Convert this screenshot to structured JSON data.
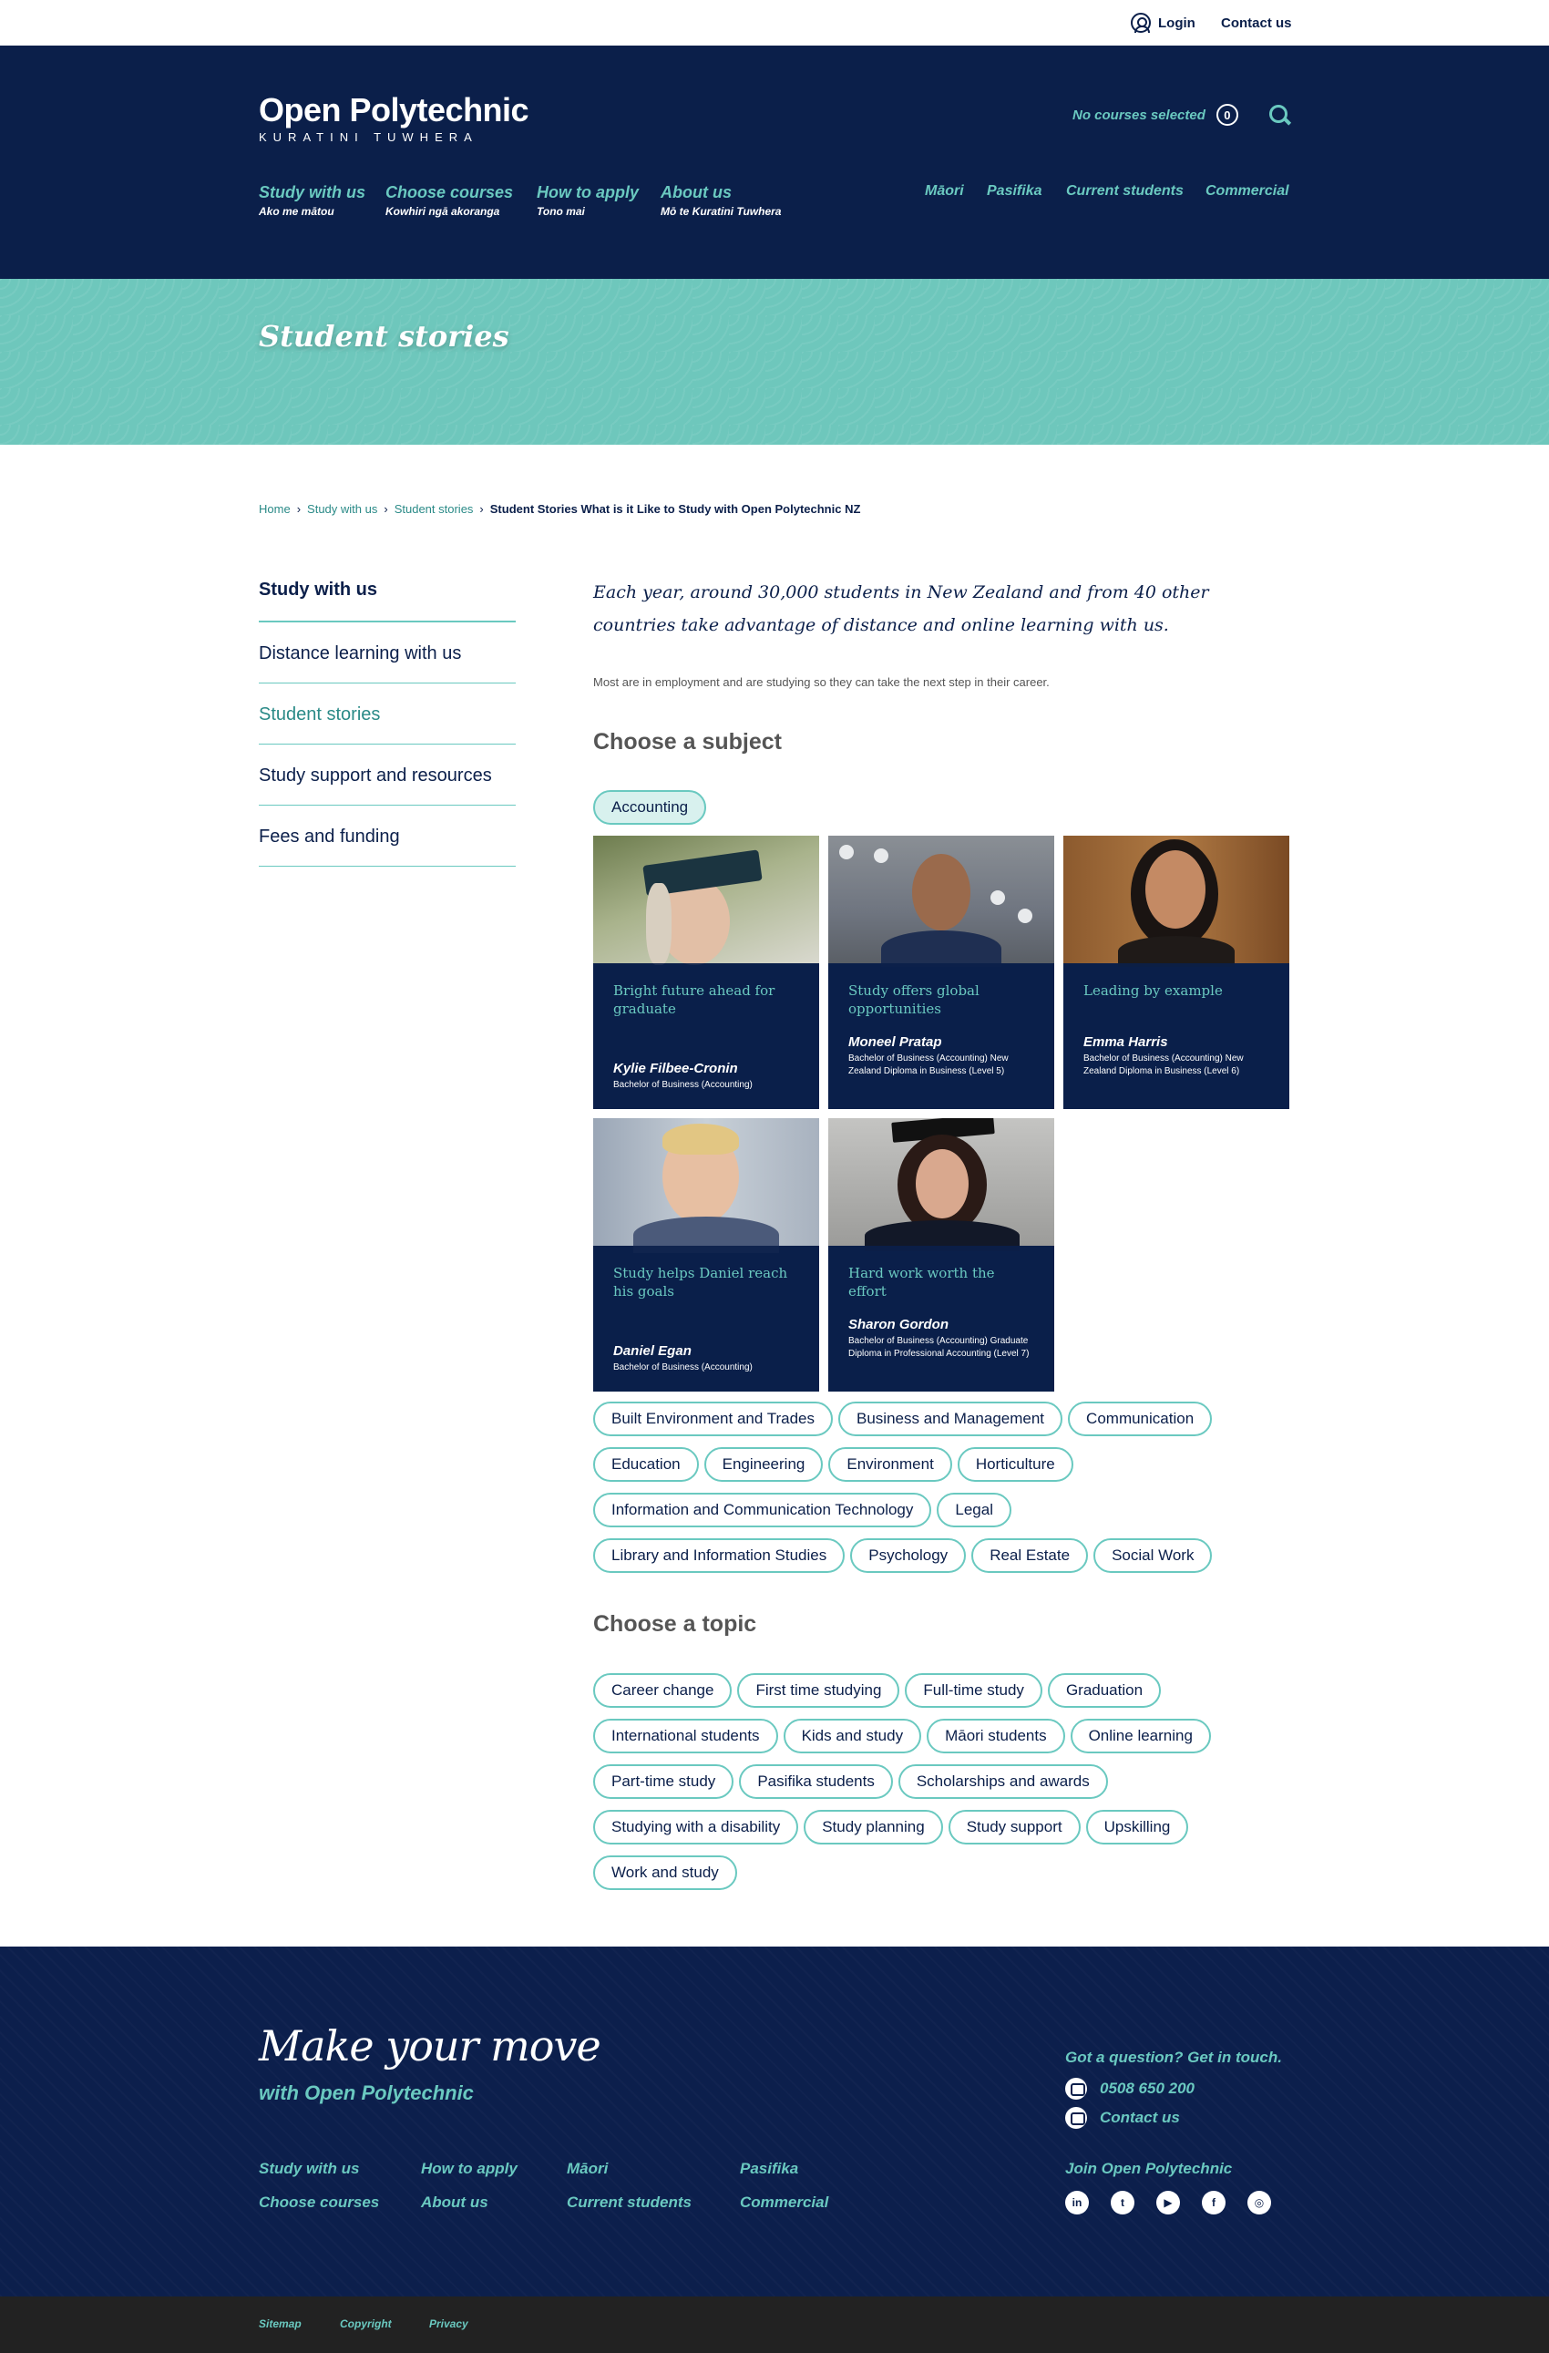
{
  "utility": {
    "login": "Login",
    "contact": "Contact us"
  },
  "header": {
    "logo_main": "Open Polytechnic",
    "logo_sub": "KURATINI TUWHERA",
    "courses_selected": "No courses selected",
    "course_count": "0",
    "nav": [
      {
        "label": "Study with us",
        "sub": "Ako me mātou"
      },
      {
        "label": "Choose courses",
        "sub": "Kowhiri ngā akoranga"
      },
      {
        "label": "How to apply",
        "sub": "Tono mai"
      },
      {
        "label": "About us",
        "sub": "Mō te Kuratini Tuwhera"
      }
    ],
    "nav_right": [
      "Māori",
      "Pasifika",
      "Current students",
      "Commercial"
    ]
  },
  "banner": {
    "title": "Student stories"
  },
  "breadcrumb": {
    "items": [
      "Home",
      "Study with us",
      "Student stories"
    ],
    "current": "Student Stories What is it Like to Study with Open Polytechnic NZ"
  },
  "sidenav": {
    "heading": "Study with us",
    "items": [
      "Distance learning with us",
      "Student stories",
      "Study support and resources",
      "Fees and funding"
    ]
  },
  "main": {
    "intro": "Each year, around 30,000 students in New Zealand and from 40 other countries take advantage of distance and online learning with us.",
    "lead": "Most are in employment and are studying so they can take the next step in their career.",
    "subject_heading": "Choose a subject",
    "selected_subject": "Accounting",
    "cards": [
      {
        "title": "Bright future ahead for graduate",
        "name": "Kylie Filbee-Cronin",
        "quals": "Bachelor of Business (Accounting)"
      },
      {
        "title": "Study offers global opportunities",
        "name": "Moneel Pratap",
        "quals": "Bachelor of Business (Accounting) New Zealand Diploma in Business (Level 5)"
      },
      {
        "title": "Leading by example",
        "name": "Emma Harris",
        "quals": "Bachelor of Business (Accounting) New Zealand Diploma in Business (Level 6)"
      },
      {
        "title": "Study helps Daniel reach his goals",
        "name": "Daniel Egan",
        "quals": "Bachelor of Business (Accounting)"
      },
      {
        "title": "Hard work worth the effort",
        "name": "Sharon Gordon",
        "quals": "Bachelor of Business (Accounting) Graduate Diploma in Professional Accounting (Level 7)"
      }
    ],
    "subjects": [
      "Built Environment and Trades",
      "Business and Management",
      "Communication",
      "Education",
      "Engineering",
      "Environment",
      "Horticulture",
      "Information and Communication Technology",
      "Legal",
      "Library and Information Studies",
      "Psychology",
      "Real Estate",
      "Social Work"
    ],
    "topic_heading": "Choose a topic",
    "topics": [
      "Career change",
      "First time studying",
      "Full-time study",
      "Graduation",
      "International students",
      "Kids and study",
      "Māori students",
      "Online learning",
      "Part-time study",
      "Pasifika students",
      "Scholarships and awards",
      "Studying with a disability",
      "Study planning",
      "Study support",
      "Upskilling",
      "Work and study"
    ]
  },
  "footer": {
    "title": "Make your move",
    "subtitle": "with Open Polytechnic",
    "links": [
      "Study with us",
      "How to apply",
      "Māori",
      "Pasifika",
      "Choose courses",
      "About us",
      "Current students",
      "Commercial"
    ],
    "question": "Got a question? Get in touch.",
    "phone": "0508 650 200",
    "contact": "Contact us",
    "join": "Join Open Polytechnic",
    "socials": [
      "linkedin-icon",
      "twitter-icon",
      "youtube-icon",
      "facebook-icon",
      "instagram-icon"
    ],
    "bottom_links": [
      "Sitemap",
      "Copyright",
      "Privacy"
    ]
  },
  "colors": {
    "navy": "#0b1f4a",
    "teal": "#6ac9c0",
    "banner_teal": "#6ec7bc",
    "dark_bar": "#222222"
  }
}
